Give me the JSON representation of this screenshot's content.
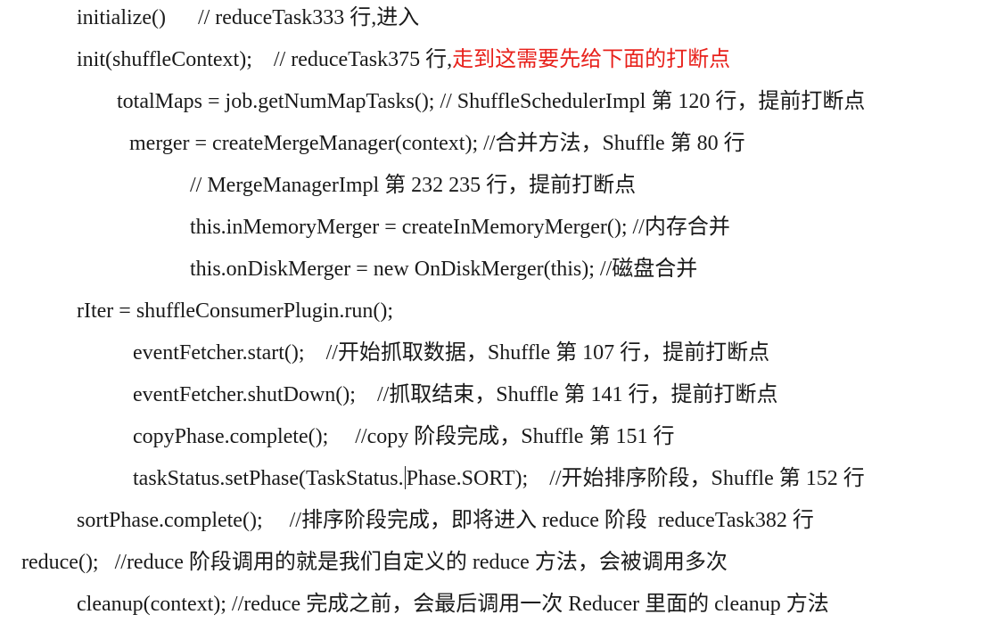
{
  "lines": [
    {
      "text": "initialize()      // reduceTask333 行,进入"
    },
    {
      "text": "init(shuffleContext);    // reduceTask375 行,",
      "highlight": "走到这需要先给下面的打断点"
    },
    {
      "text": "totalMaps = job.getNumMapTasks(); // ShuffleSchedulerImpl 第 120 行，提前打断点"
    },
    {
      "text": "merger = createMergeManager(context); //合并方法，Shuffle 第 80 行"
    },
    {
      "text": "// MergeManagerImpl 第 232 235 行，提前打断点"
    },
    {
      "text": "this.inMemoryMerger = createInMemoryMerger(); //内存合并"
    },
    {
      "text": "this.onDiskMerger = new OnDiskMerger(this); //磁盘合并"
    },
    {
      "text": "rIter = shuffleConsumerPlugin.run();"
    },
    {
      "text": "eventFetcher.start();    //开始抓取数据，Shuffle 第 107 行，提前打断点"
    },
    {
      "text": "eventFetcher.shutDown();    //抓取结束，Shuffle 第 141 行，提前打断点"
    },
    {
      "text": "copyPhase.complete();     //copy 阶段完成，Shuffle 第 151 行"
    },
    {
      "before_caret": "taskStatus.setPhase(TaskStatus.",
      "after_caret": "Phase.SORT);    //开始排序阶段，Shuffle 第 152 行"
    },
    {
      "text": "sortPhase.complete();     //排序阶段完成，即将进入 reduce 阶段  reduceTask382 行"
    },
    {
      "text": "reduce();   //reduce 阶段调用的就是我们自定义的 reduce 方法，会被调用多次"
    },
    {
      "text": "cleanup(context); //reduce 完成之前，会最后调用一次 Reducer 里面的 cleanup 方法"
    }
  ],
  "colors": {
    "text": "#1a1a1a",
    "highlight": "#e8211b"
  }
}
